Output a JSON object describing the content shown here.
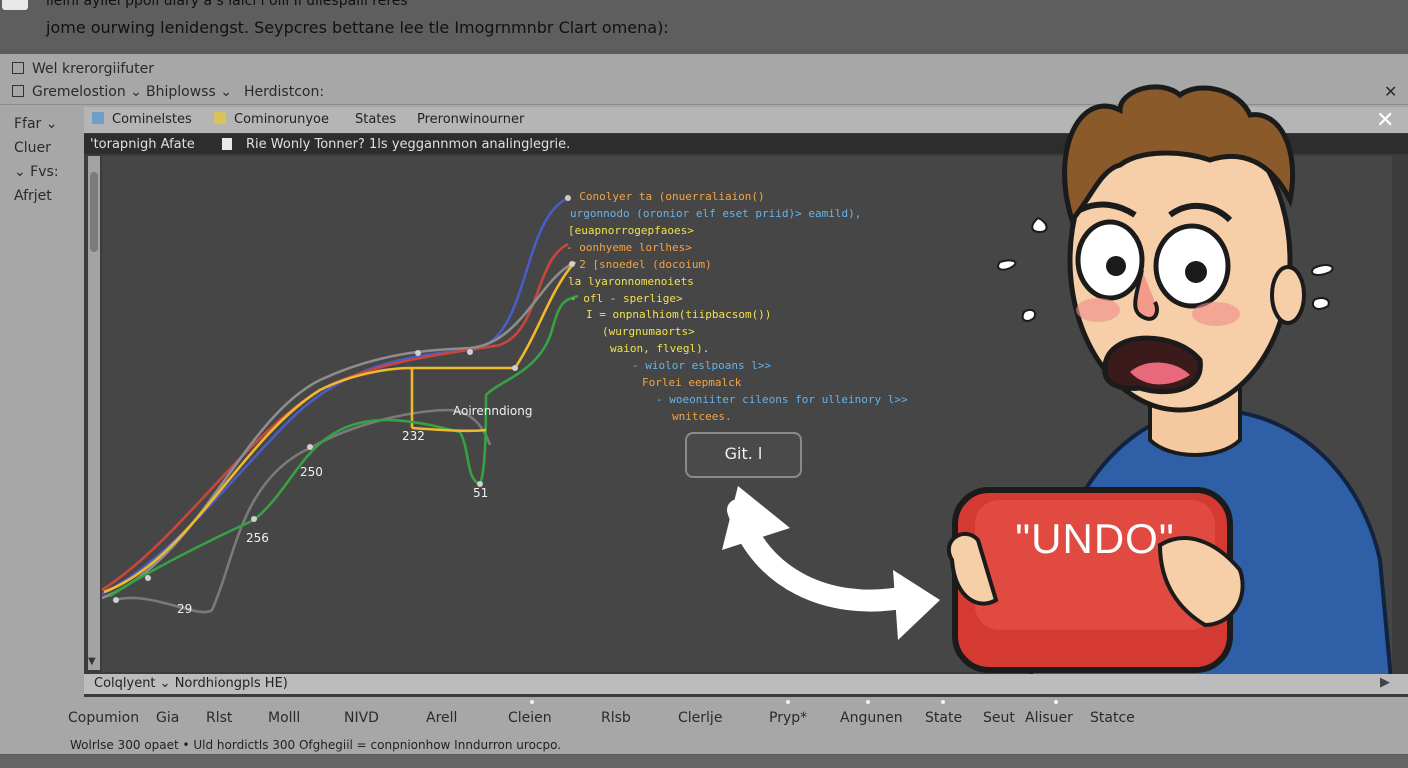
{
  "header": {
    "line1": "iieini ayilel ppoll ulary a s laicl i olii Ii uliespaill reres",
    "line2": "jome ourwing lenidengst. Seypcres bettane lee tle Imogrnmnbr Clart omena):"
  },
  "outer_tab": {
    "title": "Wel krerorgiifuter"
  },
  "outer_row2": {
    "item1": "Gremelostion ⌄",
    "item2": "Bhiplowss ⌄",
    "item3": "Herdistcon:"
  },
  "left_nav": [
    "Ffar ⌄",
    "Cluer",
    "⌄ Fvs:",
    "Afrjet"
  ],
  "panel_tabs": [
    "Cominelstes",
    "Cominorunyoe",
    "States",
    "Preronwinourner"
  ],
  "infobar": {
    "left": "'torapnigh Afate",
    "right": "Rie Wonly Tonner? 1ls yeggannmon analinglegrie."
  },
  "code_lines": [
    "- Conolyer ta (onuerraliaion()",
    "urgonnodo (oronior elf eset priid)> eamild),",
    "[euapnorrogepfaoes>",
    "- oonhyeme lorlhes>",
    "- 2 [snoedel (docoium)",
    "la lyaronnomenoiets",
    "- ofl - sperlige>",
    "I = onpnalhiom(tiipbacsom())",
    "(wurgnumaorts>",
    "waion, flvegl).",
    "- wiolor eslpoans l>>",
    "Forlei eepmalck",
    "- woeoniiter cileons for ulleinory l>>",
    "wnitcees."
  ],
  "git_button": "Git. l",
  "chart_labels": {
    "a": "Aoirenndiong",
    "p1": "232",
    "p2": "250",
    "p3": "51",
    "p4": "256",
    "p5": "29"
  },
  "illustration": {
    "sign_text": "\"UNDO\""
  },
  "statusbar": "Colqlyent ⌄ Nordhiongpls HE)",
  "bottom_items": [
    "Copumion",
    "Gia",
    "Rlst",
    "Molll",
    "NIVD",
    "Arell",
    "Cleien",
    "Rlsb",
    "Clerlje",
    "Pryp*",
    "Angunen",
    "State",
    "Seut",
    "Alisuer",
    "Statce"
  ],
  "footer_note": "Wolrlse 300 opaet • Uld hordictls 300 Ofghegiil = conpnionhow Inndurron urocpo."
}
